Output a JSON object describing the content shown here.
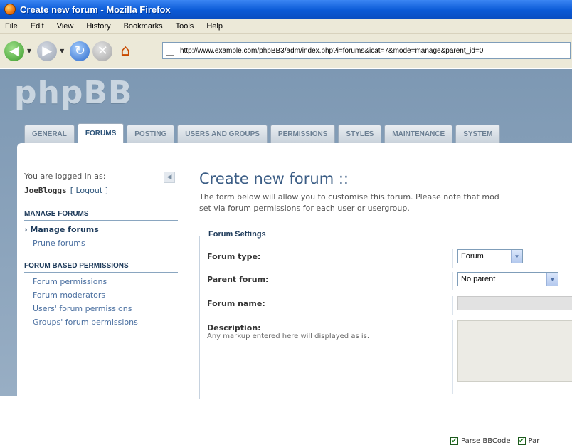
{
  "window": {
    "title": "Create new forum - Mozilla Firefox"
  },
  "menu": [
    "File",
    "Edit",
    "View",
    "History",
    "Bookmarks",
    "Tools",
    "Help"
  ],
  "address": {
    "url": "http://www.example.com/phpBB3/adm/index.php?i=forums&icat=7&mode=manage&parent_id=0"
  },
  "brand": {
    "logo": "phpBB"
  },
  "tabs": [
    "GENERAL",
    "FORUMS",
    "POSTING",
    "USERS AND GROUPS",
    "PERMISSIONS",
    "STYLES",
    "MAINTENANCE",
    "SYSTEM"
  ],
  "sidebar": {
    "logged_in_label": "You are logged in as:",
    "username": "JoeBloggs",
    "logout": "[ Logout ]",
    "section1": "MANAGE FORUMS",
    "manage_forums": "Manage forums",
    "prune_forums": "Prune forums",
    "section2": "FORUM BASED PERMISSIONS",
    "links": [
      "Forum permissions",
      "Forum moderators",
      "Users' forum permissions",
      "Groups' forum permissions"
    ]
  },
  "main": {
    "title": "Create new forum ::",
    "description_line1": "The form below will allow you to customise this forum. Please note that mod",
    "description_line2": "set via forum permissions for each user or usergroup.",
    "legend": "Forum Settings",
    "forum_type_label": "Forum type:",
    "forum_type_value": "Forum",
    "parent_forum_label": "Parent forum:",
    "parent_forum_value": "No parent",
    "forum_name_label": "Forum name:",
    "description_label": "Description:",
    "description_explain": "Any markup entered here will displayed as is.",
    "parse_bbcode": "Parse BBCode",
    "parse_partial": "Par"
  }
}
